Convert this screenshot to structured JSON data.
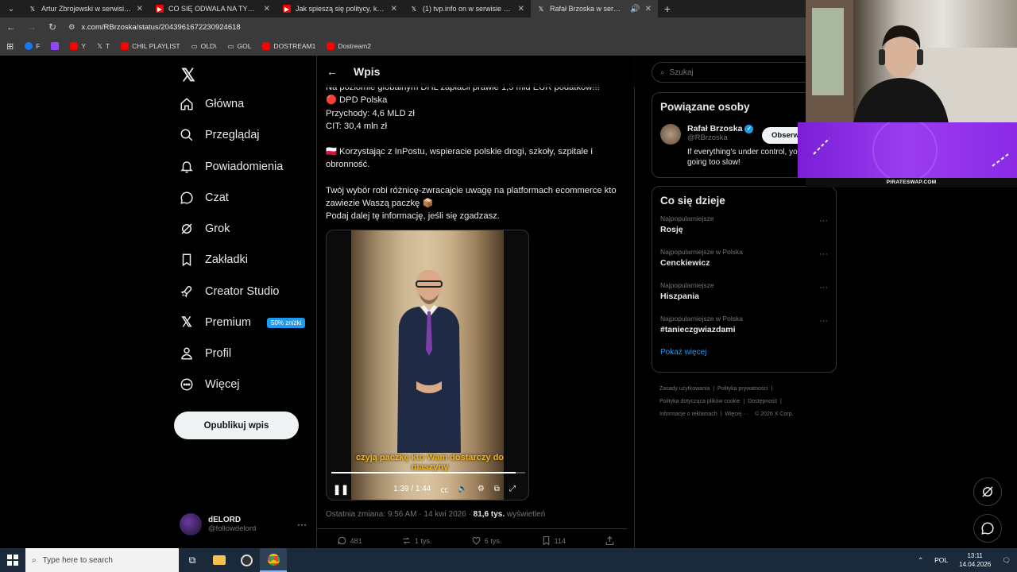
{
  "browser": {
    "tabs": [
      {
        "title": "Artur Zbrojewski w serwisie X: ...",
        "icon": "x-logo-icon",
        "active": false
      },
      {
        "title": "CO SIĘ ODWALA NA TYM TIK T...",
        "icon": "youtube-icon",
        "active": false
      },
      {
        "title": "Jak spieszą się politycy, kto i z k...",
        "icon": "youtube-icon",
        "active": false
      },
      {
        "title": "(1) tvp.info on w serwisie X: „Pie...",
        "icon": "x-logo-icon",
        "active": false
      },
      {
        "title": "Rafał Brzoska w serwisie X:...",
        "icon": "x-logo-icon",
        "active": true
      }
    ],
    "url": "x.com/RBrzoska/status/2043961672230924618",
    "bookmarks": [
      {
        "label": "F",
        "color": "#1877f2"
      },
      {
        "label": "",
        "color": "#9146ff"
      },
      {
        "label": "Y",
        "color": "#ff0000"
      },
      {
        "label": "T",
        "color": "#000000"
      },
      {
        "label": "CHIL PLAYLIST",
        "color": "#ff0000"
      },
      {
        "label": "OLD\\",
        "color": "folder"
      },
      {
        "label": "GOL",
        "color": "folder"
      },
      {
        "label": "DOSTREAM1",
        "color": "#ff0000"
      },
      {
        "label": "Dostream2",
        "color": "#ff0000"
      }
    ]
  },
  "nav": {
    "logo": "𝕏",
    "items": [
      {
        "label": "Główna",
        "icon": "home-icon"
      },
      {
        "label": "Przeglądaj",
        "icon": "search-icon"
      },
      {
        "label": "Powiadomienia",
        "icon": "bell-icon"
      },
      {
        "label": "Czat",
        "icon": "chat-icon"
      },
      {
        "label": "Grok",
        "icon": "grok-icon"
      },
      {
        "label": "Zakładki",
        "icon": "bookmark-icon"
      },
      {
        "label": "Creator Studio",
        "icon": "rocket-icon"
      },
      {
        "label": "Premium",
        "icon": "x-logo-icon",
        "badge": "50% zniżki"
      },
      {
        "label": "Profil",
        "icon": "person-icon"
      },
      {
        "label": "Więcej",
        "icon": "more-circle-icon"
      }
    ],
    "post_button": "Opublikuj wpis",
    "account": {
      "name": "dELORD",
      "handle": "@followdelord"
    }
  },
  "post": {
    "header": "Wpis",
    "lines": [
      "Na poziomie globalnym DHL zapłacił prawie 1,5 mld EUR podatków!!!",
      "🔴 DPD Polska",
      "Przychody: 4,6 MLD zł",
      "CIT: 30,4 mln zł",
      "",
      "🇵🇱 Korzystając z InPostu, wspieracie polskie drogi, szkoły, szpitale i obronność.",
      "",
      "Twój wybór robi różnicę-zwracajcie uwagę na platformach ecommerce kto zawiezie Waszą paczkę 📦",
      "Podaj dalej tę informację, jeśli się zgadzasz."
    ],
    "video": {
      "caption": "czyją paczkę kto Wam dostarczy do maszyny",
      "time": "1:39 / 1:44",
      "progress": 0.95
    },
    "meta_time": "Ostatnia zmiana: 9:56 AM · 14 kwi 2026 · ",
    "views_count": "81,6 tys.",
    "views_label": " wyświetleń",
    "stats": {
      "replies": "481",
      "reposts": "1 tys.",
      "likes": "6 tys.",
      "bookmarks": "114"
    }
  },
  "sidebar": {
    "search_placeholder": "Szukaj",
    "related_title": "Powiązane osoby",
    "related": {
      "name": "Rafał Brzoska",
      "handle": "@RBrzoska",
      "bio": "If everything's under control, you're going too slow!",
      "follow": "Obserwuj"
    },
    "trends_title": "Co się dzieje",
    "trends": [
      {
        "category": "Najpopularniejsze",
        "name": "Rosję"
      },
      {
        "category": "Najpopularniejsze w Polska",
        "name": "Cenckiewicz"
      },
      {
        "category": "Najpopularniejsze",
        "name": "Hiszpania"
      },
      {
        "category": "Najpopularniejsze w Polska",
        "name": "#tanieczgwiazdami"
      }
    ],
    "show_more": "Pokaż więcej",
    "footer_links": [
      "Zasady użytkowania",
      "Polityka prywatności",
      "Polityka dotycząca plików cookie",
      "Dostępność",
      "Informacje o reklamach",
      "Więcej ···",
      "© 2026 X Corp."
    ]
  },
  "overlay": {
    "sponsor": "PIRATESWAP.COM"
  },
  "taskbar": {
    "search_placeholder": "Type here to search",
    "lang": "POL",
    "time": "13:11",
    "date": "14.04.2026"
  },
  "colors": {
    "accent": "#1d9bf0",
    "bg": "#000000",
    "border": "#2f3336",
    "muted": "#71767b",
    "caption": "#f1b51a"
  }
}
